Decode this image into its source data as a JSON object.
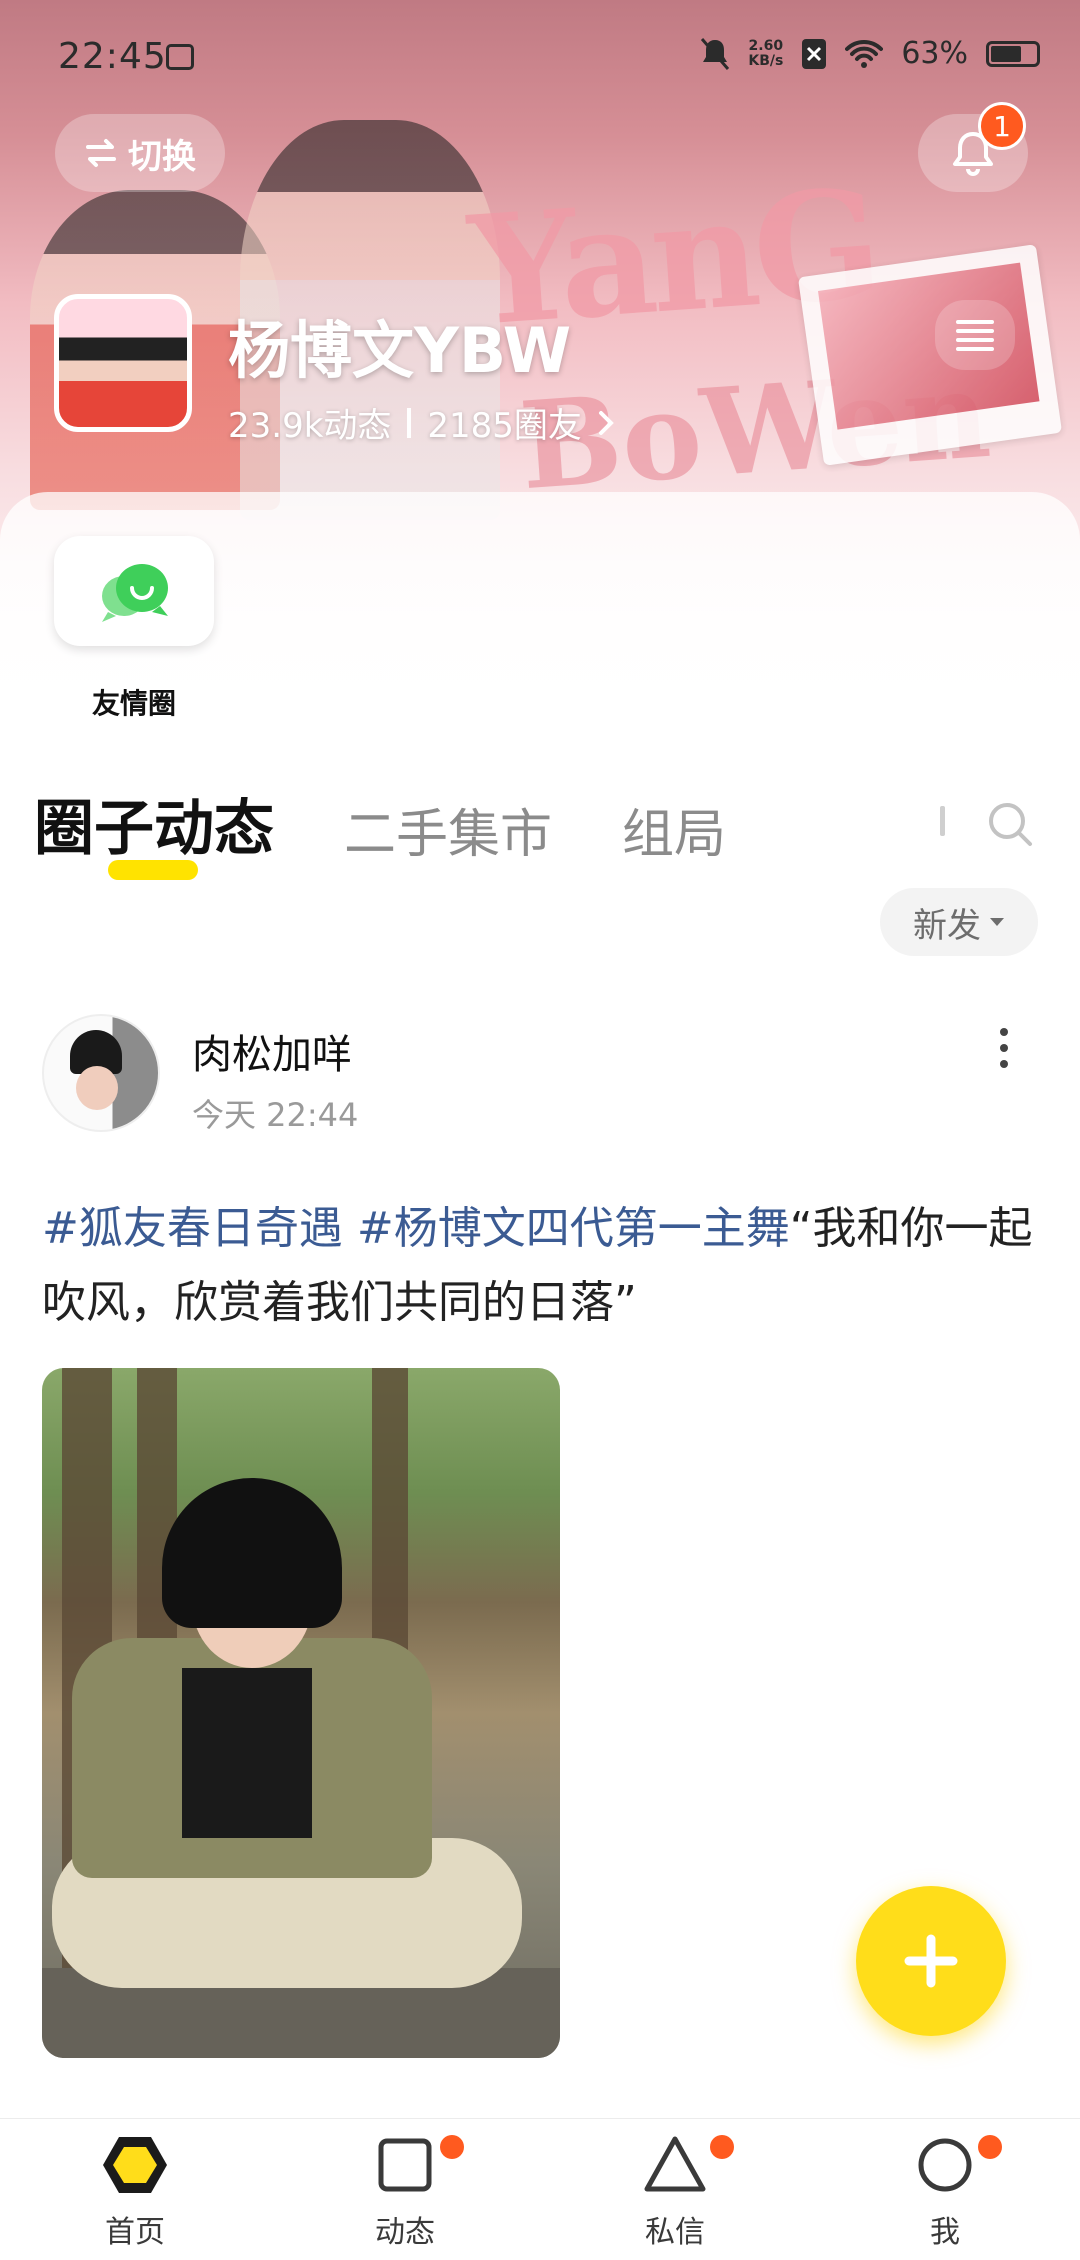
{
  "status_bar": {
    "time": "22:45",
    "net_speed_value": "2.60",
    "net_speed_unit": "KB/s",
    "battery": "63%"
  },
  "header": {
    "switch_label": "切换",
    "notification_count": "1",
    "circle_name": "杨博文YBW",
    "posts_count": "23.9k动态",
    "members_count": "2185圈友",
    "banner_text_1": "YanG",
    "banner_text_2": "BoWen"
  },
  "shortcuts": [
    {
      "label": "友情圈",
      "icon": "chat-bubbles-icon",
      "color": "#3fcf5a"
    }
  ],
  "tabs": [
    {
      "label": "圈子动态",
      "active": true
    },
    {
      "label": "二手集市",
      "active": false
    },
    {
      "label": "组局",
      "active": false
    }
  ],
  "sort": {
    "label": "新发"
  },
  "post": {
    "author": "肉松加咩",
    "time": "今天 22:44",
    "tag1": "#狐友春日奇遇",
    "tag2": "#杨博文四代第一主舞",
    "text": "“我和你一起吹风，欣赏着我们共同的日落”"
  },
  "fab": {
    "icon": "plus-icon",
    "color": "#ffdd1a"
  },
  "bottom_nav": [
    {
      "label": "首页",
      "icon": "hexagon-home-icon",
      "active": true,
      "dot": false
    },
    {
      "label": "动态",
      "icon": "square-feed-icon",
      "active": false,
      "dot": true
    },
    {
      "label": "私信",
      "icon": "triangle-message-icon",
      "active": false,
      "dot": true
    },
    {
      "label": "我",
      "icon": "circle-profile-icon",
      "active": false,
      "dot": true
    }
  ],
  "colors": {
    "accent_yellow": "#ffe300",
    "badge_orange": "#ff5a1f",
    "tag_blue": "#3b5b93"
  }
}
